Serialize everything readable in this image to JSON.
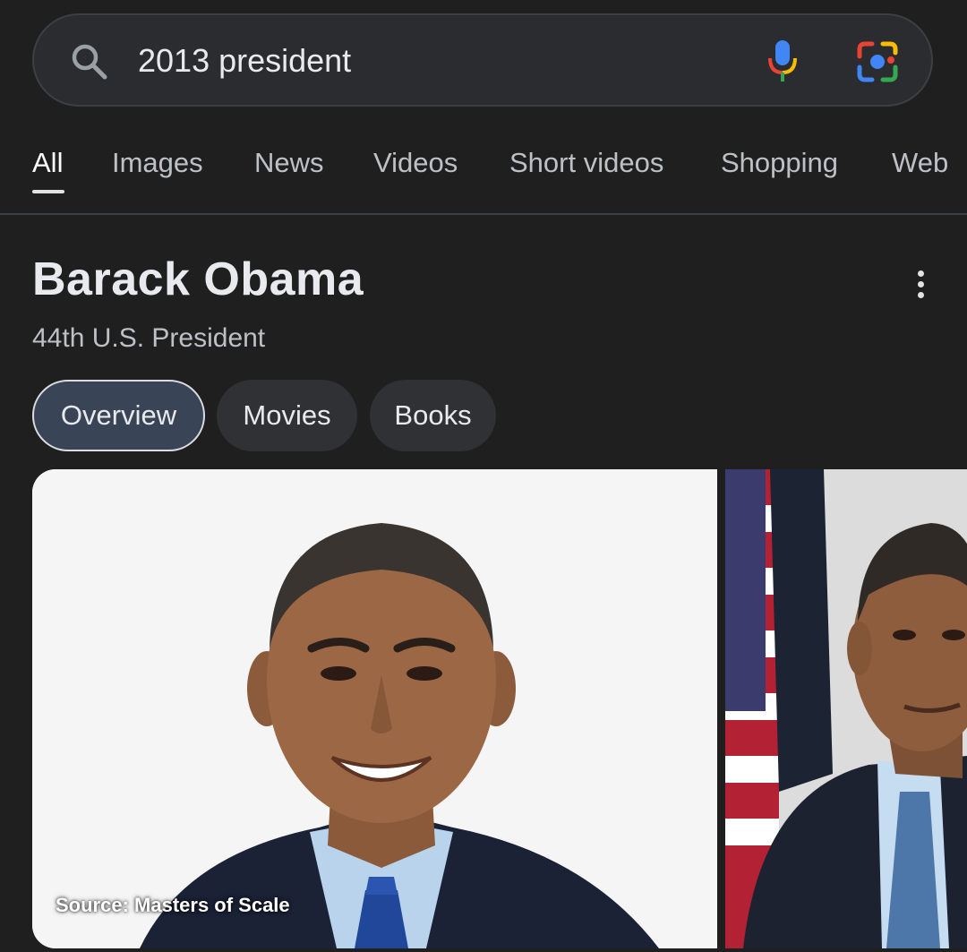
{
  "search": {
    "query": "2013 president",
    "icons": {
      "search": "search-icon",
      "voice": "mic-icon",
      "lens": "google-lens-icon"
    }
  },
  "tabs": [
    {
      "label": "All",
      "active": true
    },
    {
      "label": "Images"
    },
    {
      "label": "News"
    },
    {
      "label": "Videos"
    },
    {
      "label": "Short videos"
    },
    {
      "label": "Shopping"
    },
    {
      "label": "Web"
    }
  ],
  "entity": {
    "title": "Barack Obama",
    "subtitle": "44th U.S. President"
  },
  "chips": [
    {
      "label": "Overview",
      "selected": true
    },
    {
      "label": "Movies"
    },
    {
      "label": "Books"
    }
  ],
  "images": [
    {
      "source": "Source: Masters of Scale"
    }
  ],
  "colors": {
    "background": "#1f1f1f",
    "search_bar": "#2b2c2f",
    "chip": "#303134",
    "chip_selected": "#394457",
    "text_primary": "#e8eaed",
    "text_secondary": "#bdc1c6"
  }
}
